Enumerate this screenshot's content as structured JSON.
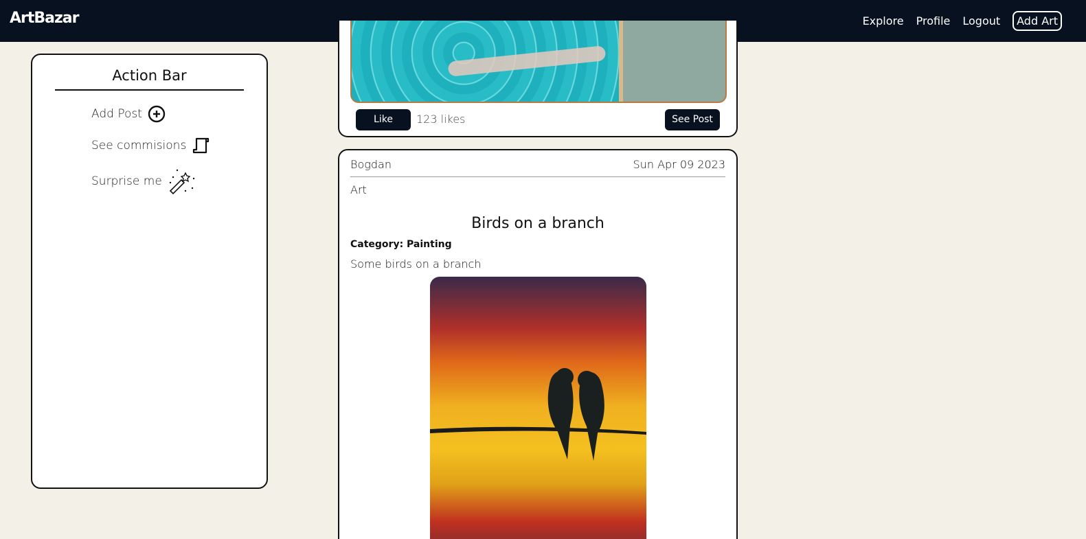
{
  "nav": {
    "logo": "ArtBazar",
    "links": [
      "Explore",
      "Profile",
      "Logout"
    ],
    "add_art": "Add Art"
  },
  "action_bar": {
    "title": "Action Bar",
    "items": [
      {
        "label": "Add Post",
        "icon": "plus-circle-icon"
      },
      {
        "label": "See commisions",
        "icon": "scroll-icon"
      },
      {
        "label": "Surprise me",
        "icon": "magic-wand-icon"
      }
    ]
  },
  "posts": [
    {
      "like_label": "Like",
      "likes": "123 likes",
      "see_post": "See Post"
    },
    {
      "author": "Bogdan",
      "date": "Sun Apr 09 2023",
      "tag": "Art",
      "title": "Birds on a branch",
      "category": "Category: Painting",
      "description": "Some birds on a branch"
    }
  ],
  "colors": {
    "nav_bg": "#081120",
    "page_bg": "#f3f0e8",
    "button_bg": "#081120"
  }
}
